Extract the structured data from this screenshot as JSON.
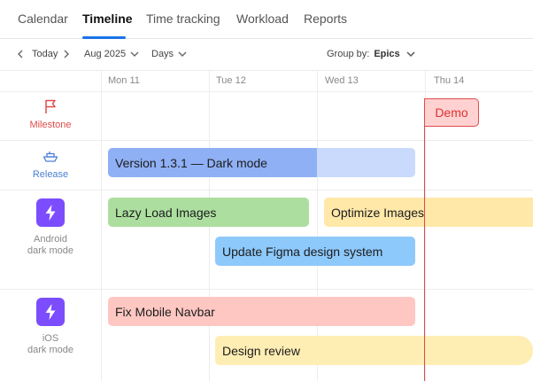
{
  "tabs": [
    {
      "label": "Calendar",
      "active": false
    },
    {
      "label": "Timeline",
      "active": true
    },
    {
      "label": "Time tracking",
      "active": false
    },
    {
      "label": "Workload",
      "active": false
    },
    {
      "label": "Reports",
      "active": false
    }
  ],
  "toolbar": {
    "today_label": "Today",
    "month_label": "Aug 2025",
    "scale_label": "Days",
    "group_by_label": "Group by:",
    "group_by_value": "Epics"
  },
  "days": [
    "Mon 11",
    "Tue 12",
    "Wed 13",
    "Thu 14"
  ],
  "rows": {
    "milestone": {
      "label": "Milestone",
      "icon": "flag-icon",
      "color": "#e04b4b"
    },
    "release": {
      "label": "Release",
      "icon": "ship-icon",
      "color": "#4a7fd6"
    },
    "android": {
      "label_line1": "Android",
      "label_line2": "dark mode",
      "icon": "lightning-icon"
    },
    "ios": {
      "label_line1": "iOS",
      "label_line2": "dark mode",
      "icon": "lightning-icon"
    }
  },
  "bars": {
    "version": {
      "label": "Version 1.3.1 — Dark mode",
      "progress": 0.68
    },
    "lazy_load": {
      "label": "Lazy Load Images"
    },
    "optimize": {
      "label": "Optimize Images"
    },
    "figma": {
      "label": "Update Figma design system"
    },
    "navbar": {
      "label": "Fix Mobile Navbar"
    },
    "design_review": {
      "label": "Design review"
    }
  },
  "milestone_tag": {
    "label": "Demo"
  },
  "colors": {
    "accent": "#1a73e8",
    "today_line": "#d84a4a",
    "purple": "#7c4dff",
    "bar_blue_done": "#8fb0f5",
    "bar_blue_rest": "#c9dafc",
    "bar_green": "#acdf9f",
    "bar_yellow": "#ffe8a8",
    "bar_lightblue": "#8ec9fb",
    "bar_red": "#ffc7c2",
    "bar_yellow_light": "#ffeeb3"
  }
}
